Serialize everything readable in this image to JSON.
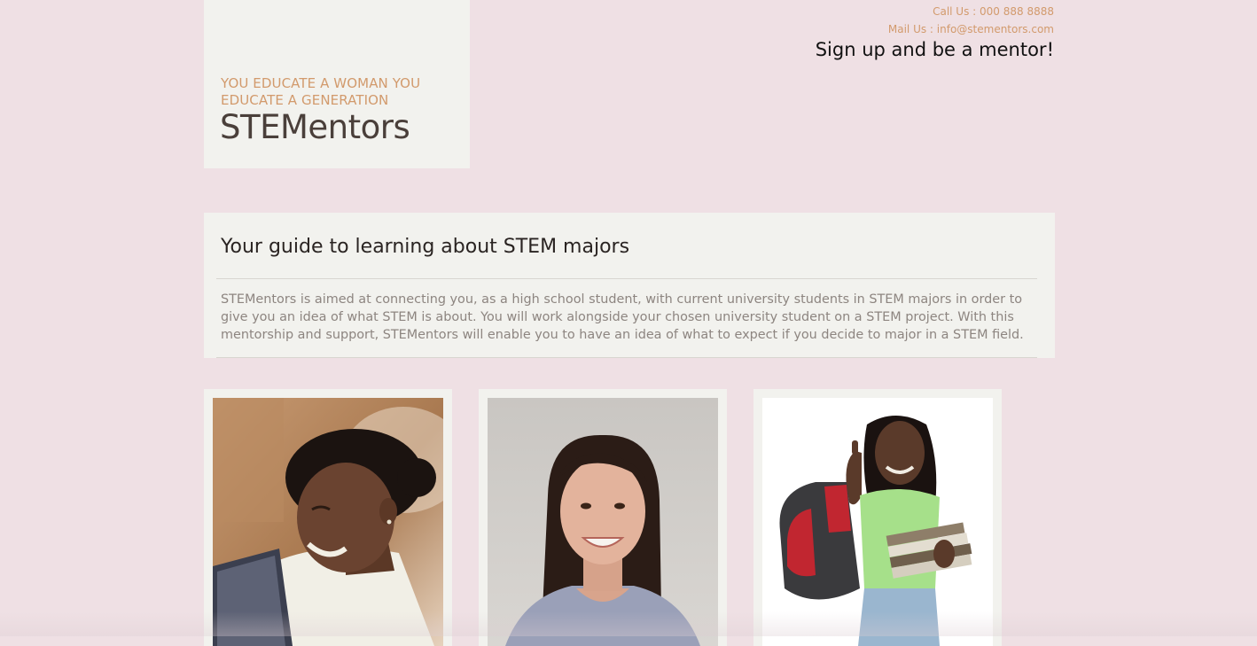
{
  "header": {
    "tagline": "YOU EDUCATE A WOMAN YOU EDUCATE A GENERATION",
    "site_name": "STEMentors",
    "phone": "Call Us : 000 888 8888",
    "mail": "Mail Us : info@stementors.com",
    "cta": "Sign up and be a mentor!"
  },
  "intro": {
    "title": "Your guide to learning about STEM majors",
    "body": "STEMentors is aimed at connecting you, as a high school student, with current university students in STEM majors in order to give you an idea of what STEM is about. You will work alongside your chosen university student on a STEM project. With this mentorship and support, STEMentors will enable you to have an idea of what to expect if you decide to major in a STEM field."
  },
  "cards": [
    {
      "photo": "woman-at-laptop-photo"
    },
    {
      "photo": "smiling-woman-portrait-photo"
    },
    {
      "photo": "student-thumbs-up-photo"
    }
  ],
  "colors": {
    "background": "#efe0e4",
    "panel": "#f2f2ee",
    "accent": "#d29a6c",
    "heading": "#2a2422",
    "body_text": "#8d8580"
  }
}
